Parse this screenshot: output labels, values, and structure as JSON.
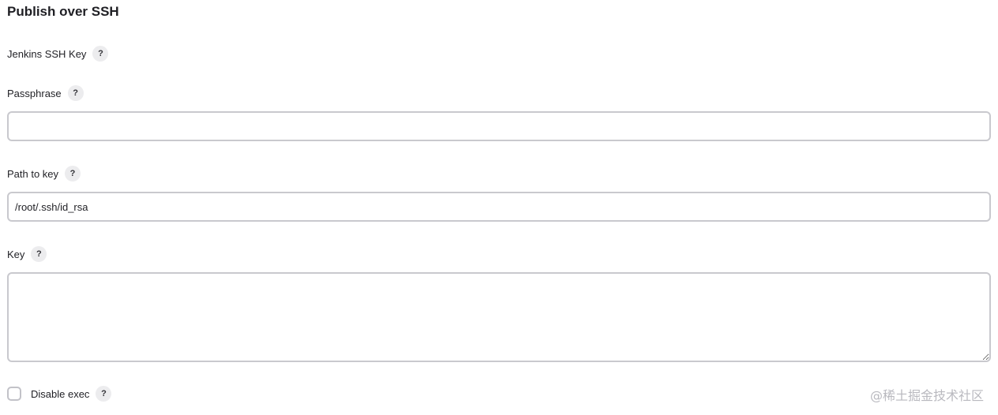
{
  "section": {
    "title": "Publish over SSH"
  },
  "fields": {
    "jenkins_ssh_key": {
      "label": "Jenkins SSH Key",
      "help": "?"
    },
    "passphrase": {
      "label": "Passphrase",
      "help": "?",
      "value": ""
    },
    "path_to_key": {
      "label": "Path to key",
      "help": "?",
      "value": "/root/.ssh/id_rsa"
    },
    "key": {
      "label": "Key",
      "help": "?",
      "value": ""
    },
    "disable_exec": {
      "label": "Disable exec",
      "help": "?",
      "checked": false
    }
  },
  "watermark": "@稀土掘金技术社区"
}
